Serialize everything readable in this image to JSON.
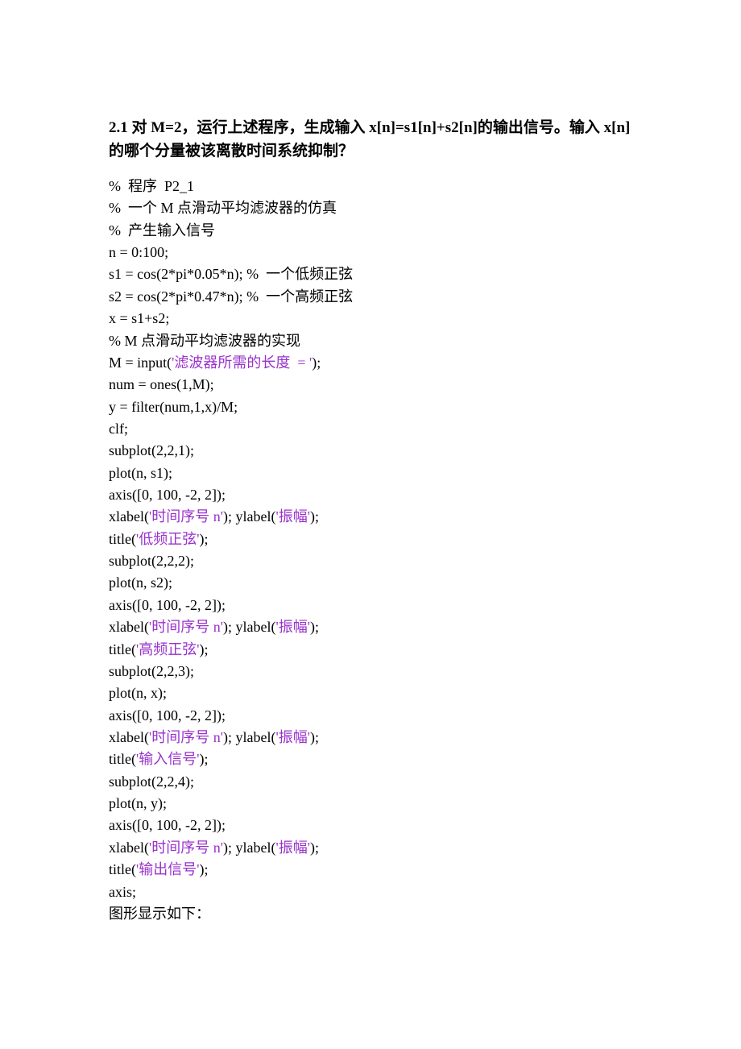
{
  "heading": {
    "line1": "2.1 对 M=2，运行上述程序，生成输入 x[n]=s1[n]+s2[n]的输出信号。输入 x[n]",
    "line2": "的哪个分量被该离散时间系统抑制？"
  },
  "code": {
    "l1": "%  程序  P2_1",
    "l2": "%  一个 M 点滑动平均滤波器的仿真",
    "l3": "%  产生输入信号",
    "l4": "n = 0:100;",
    "l5a": "s1 = cos(2*pi*0.05*n); %",
    "l5b": "  一个低频正弦",
    "l6a": "s2 = cos(2*pi*0.47*n); %",
    "l6b": "  一个高频正弦",
    "l7": "x = s1+s2;",
    "l8": "% M 点滑动平均滤波器的实现",
    "l9a": "M = input(",
    "l9b": "'滤波器所需的长度  = '",
    "l9c": ");",
    "l10": "num = ones(1,M);",
    "l11": "y = filter(num,1,x)/M;",
    "l12": "clf;",
    "l13": "subplot(2,2,1);",
    "l14": "plot(n, s1);",
    "l15": "axis([0, 100, -2, 2]);",
    "l16a": "xlabel(",
    "l16b": "'时间序号 n'",
    "l16c": "); ylabel(",
    "l16d": "'振幅'",
    "l16e": ");",
    "l17a": "title(",
    "l17b": "'低频正弦'",
    "l17c": ");",
    "l18": "subplot(2,2,2);",
    "l19": "plot(n, s2);",
    "l20": "axis([0, 100, -2, 2]);",
    "l21a": "xlabel(",
    "l21b": "'时间序号 n'",
    "l21c": "); ylabel(",
    "l21d": "'振幅'",
    "l21e": ");",
    "l22a": "title(",
    "l22b": "'高频正弦'",
    "l22c": ");",
    "l23": "subplot(2,2,3);",
    "l24": "plot(n, x);",
    "l25": "axis([0, 100, -2, 2]);",
    "l26a": "xlabel(",
    "l26b": "'时间序号 n'",
    "l26c": "); ylabel(",
    "l26d": "'振幅'",
    "l26e": ");",
    "l27a": "title(",
    "l27b": "'输入信号'",
    "l27c": ");",
    "l28": "subplot(2,2,4);",
    "l29": "plot(n, y);",
    "l30": "axis([0, 100, -2, 2]);",
    "l31a": "xlabel(",
    "l31b": "'时间序号 n'",
    "l31c": "); ylabel(",
    "l31d": "'振幅'",
    "l31e": ");",
    "l32a": "title(",
    "l32b": "'输出信号'",
    "l32c": ");",
    "l33": "axis;",
    "l34": "图形显示如下："
  }
}
